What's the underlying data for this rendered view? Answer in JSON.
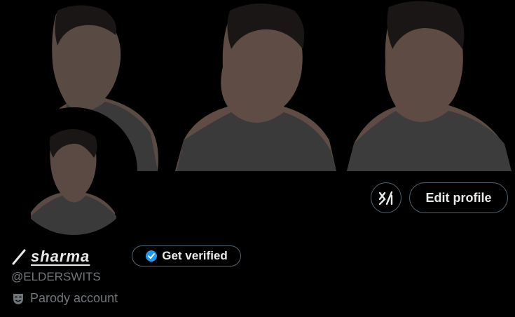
{
  "profile": {
    "display_name": "sharma",
    "handle": "@ELDERSWITS",
    "label": "Parody account"
  },
  "actions": {
    "grok_icon": "grok-icon",
    "edit_profile": "Edit profile",
    "get_verified": "Get verified"
  },
  "colors": {
    "verified_badge": "#1d9bf0",
    "border": "#536471",
    "muted_text": "#71767b",
    "text": "#e7e9ea"
  }
}
